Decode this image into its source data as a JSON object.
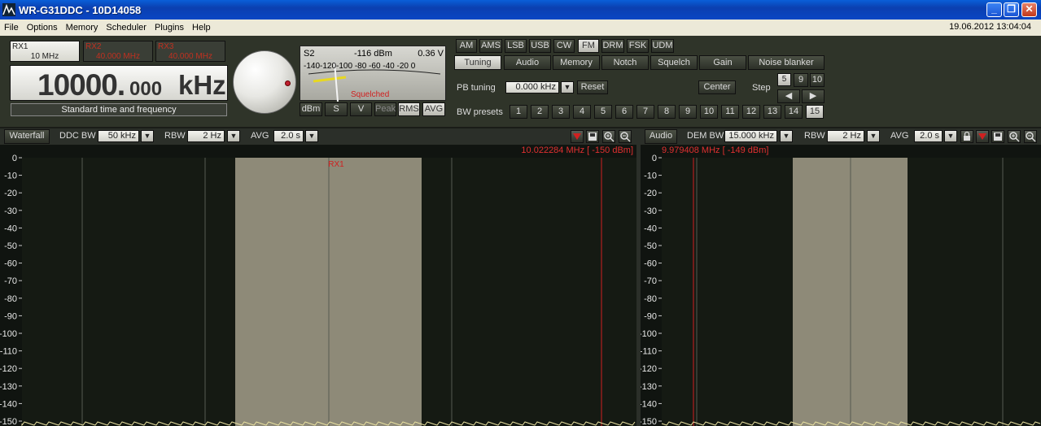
{
  "window": {
    "title": "WR-G31DDC - 10D14058"
  },
  "menu": {
    "items": [
      "File",
      "Options",
      "Memory",
      "Scheduler",
      "Plugins",
      "Help"
    ],
    "datetime": "19.06.2012 13:04:04"
  },
  "receivers": [
    {
      "name": "RX1",
      "freq": "10 MHz"
    },
    {
      "name": "RX2",
      "freq": "40.000 MHz"
    },
    {
      "name": "RX3",
      "freq": "40.000 MHz"
    }
  ],
  "frequency": {
    "main": "10000.",
    "fraction": "000",
    "unit": "kHz",
    "station": "Standard time and frequency"
  },
  "smeter": {
    "s_unit": "S2",
    "dbm_value": "-116 dBm",
    "voltage": "0.36  V",
    "scale": "-140-120-100 -80 -60 -40 -20   0",
    "status": "Squelched",
    "level_fraction": 0.22,
    "buttons": [
      "dBm",
      "S",
      "V",
      "Peak",
      "RMS",
      "AVG"
    ]
  },
  "modes": [
    "AM",
    "AMS",
    "LSB",
    "USB",
    "CW",
    "FM",
    "DRM",
    "FSK",
    "UDM"
  ],
  "selected_mode": "FM",
  "tabs": [
    "Tuning",
    "Audio",
    "Memory",
    "Notch",
    "Squelch",
    "Gain",
    "Noise blanker"
  ],
  "tuning": {
    "pb_label": "PB tuning",
    "pb_value": "0.000 kHz",
    "reset": "Reset",
    "center": "Center",
    "step_label": "Step",
    "steps": [
      "5",
      "9",
      "10"
    ],
    "bw_presets_label": "BW presets",
    "bw_presets": [
      "1",
      "2",
      "3",
      "4",
      "5",
      "6",
      "7",
      "8",
      "9",
      "10",
      "11",
      "12",
      "13",
      "14",
      "15"
    ]
  },
  "left_panel": {
    "mode_btn": "Waterfall",
    "bw_label": "DDC BW",
    "bw_value": "50 kHz",
    "rbw_label": "RBW",
    "rbw_value": "2 Hz",
    "avg_label": "AVG",
    "avg_value": "2.0 s",
    "cursor": "10.022284 MHz [ -150 dBm]",
    "marker": "RX1",
    "yticks": [
      "0",
      "-10",
      "-20",
      "-30",
      "-40",
      "-50",
      "-60",
      "-70",
      "-80",
      "-90",
      "-100",
      "-110",
      "-120",
      "-130",
      "-140",
      "-150"
    ]
  },
  "right_panel": {
    "mode_btn": "Audio",
    "bw_label": "DEM BW",
    "bw_value": "15.000 kHz",
    "rbw_label": "RBW",
    "rbw_value": "2 Hz",
    "avg_label": "AVG",
    "avg_value": "2.0 s",
    "cursor": "9.979408 MHz [ -149 dBm]",
    "yticks": [
      "0",
      "-10",
      "-20",
      "-30",
      "-40",
      "-50",
      "-60",
      "-70",
      "-80",
      "-90",
      "-100",
      "-110",
      "-120",
      "-130",
      "-140",
      "-150"
    ]
  },
  "colors": {
    "accent": "#d02020",
    "band": "#8e8a78",
    "plot_bg": "#151a13"
  }
}
